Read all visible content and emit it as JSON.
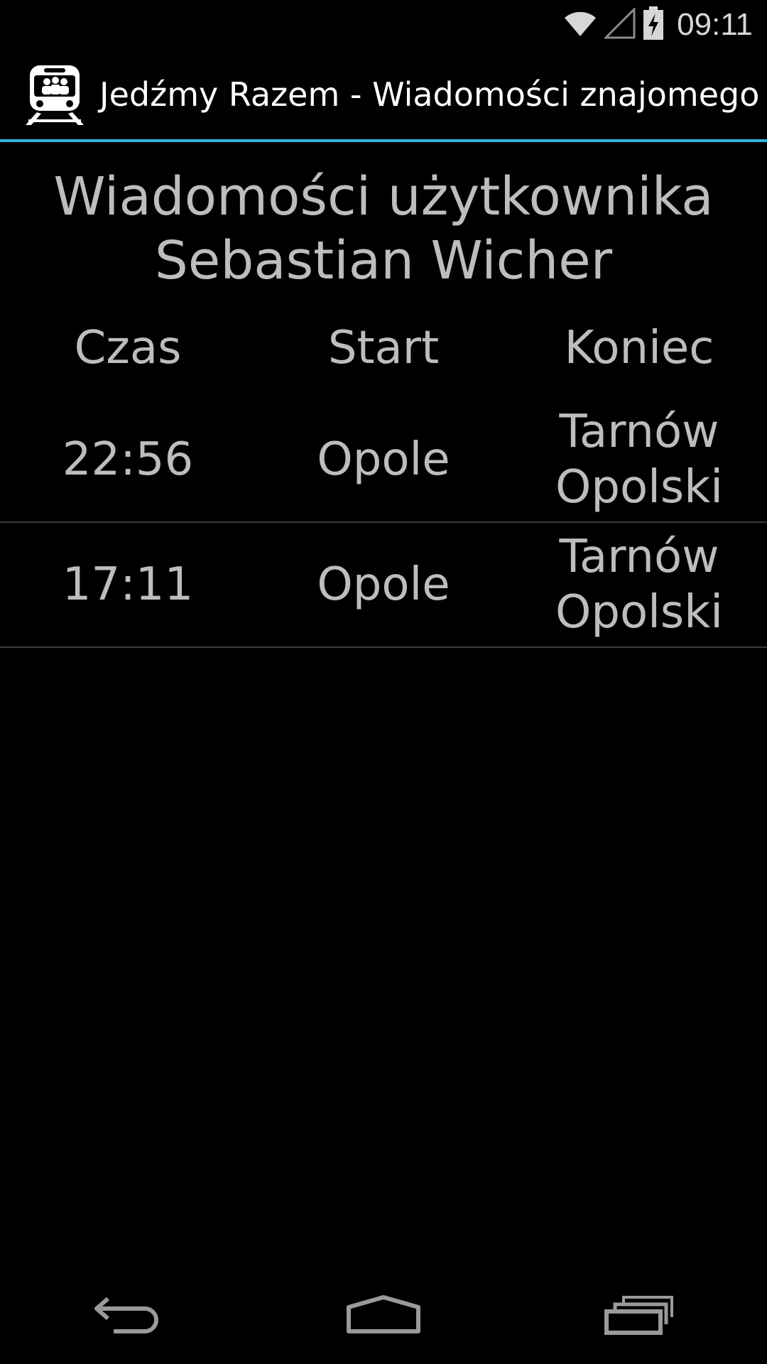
{
  "status_bar": {
    "time": "09:11",
    "icons": [
      "wifi-icon",
      "signal-icon",
      "battery-charging-icon"
    ]
  },
  "action_bar": {
    "app_icon": "train-people-icon",
    "title": "Jedźmy Razem - Wiadomości znajomego"
  },
  "heading": {
    "line1": "Wiadomości użytkownika",
    "line2": "Sebastian Wicher"
  },
  "table": {
    "columns": [
      "Czas",
      "Start",
      "Koniec"
    ],
    "rows": [
      {
        "time": "22:56",
        "start": "Opole",
        "end": "Tarnów\nOpolski"
      },
      {
        "time": "17:11",
        "start": "Opole",
        "end": "Tarnów\nOpolski"
      }
    ]
  },
  "nav_bar": {
    "buttons": [
      "back-icon",
      "home-icon",
      "recent-apps-icon"
    ]
  },
  "colors": {
    "accent": "#33b5e5",
    "background": "#000000",
    "text": "#bdbdbd"
  }
}
